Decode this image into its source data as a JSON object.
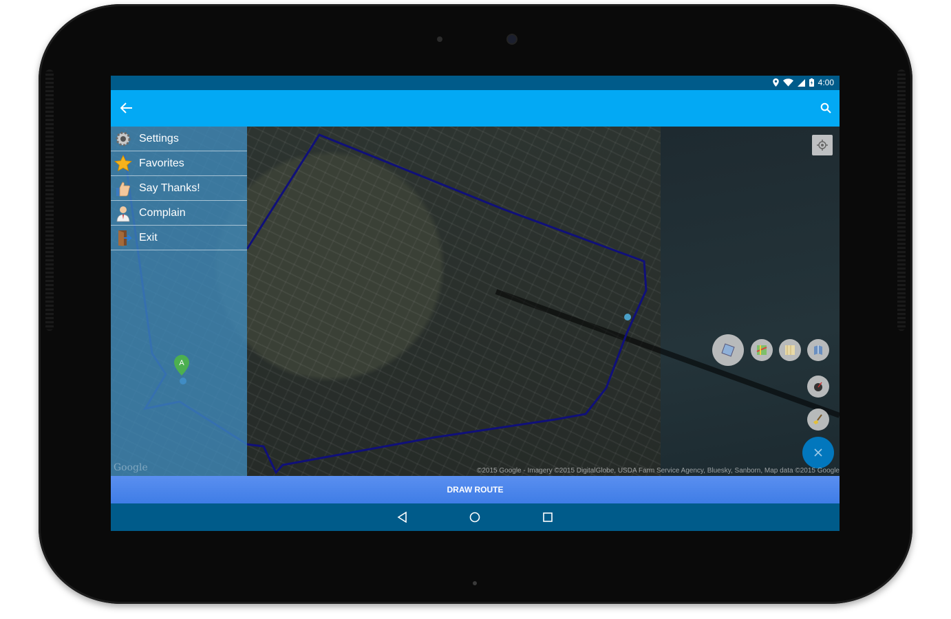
{
  "status_bar": {
    "time": "4:00"
  },
  "drawer": {
    "items": [
      {
        "label": "Settings",
        "icon": "gear-icon"
      },
      {
        "label": "Favorites",
        "icon": "star-icon"
      },
      {
        "label": "Say Thanks!",
        "icon": "thumbs-up-icon"
      },
      {
        "label": "Complain",
        "icon": "person-icon"
      },
      {
        "label": "Exit",
        "icon": "exit-door-icon"
      }
    ],
    "google_watermark": "Google"
  },
  "map": {
    "attribution": "©2015 Google - Imagery ©2015 DigitalGlobe, USDA Farm Service Agency, Bluesky, Sanborn, Map data ©2015 Google",
    "marker_label": "A"
  },
  "actions": {
    "draw_route": "DRAW ROUTE"
  },
  "colors": {
    "status_bar": "#005b8a",
    "app_bar": "#03a9f4",
    "route": "#10107a",
    "bottom_button": "#4a86ea"
  }
}
